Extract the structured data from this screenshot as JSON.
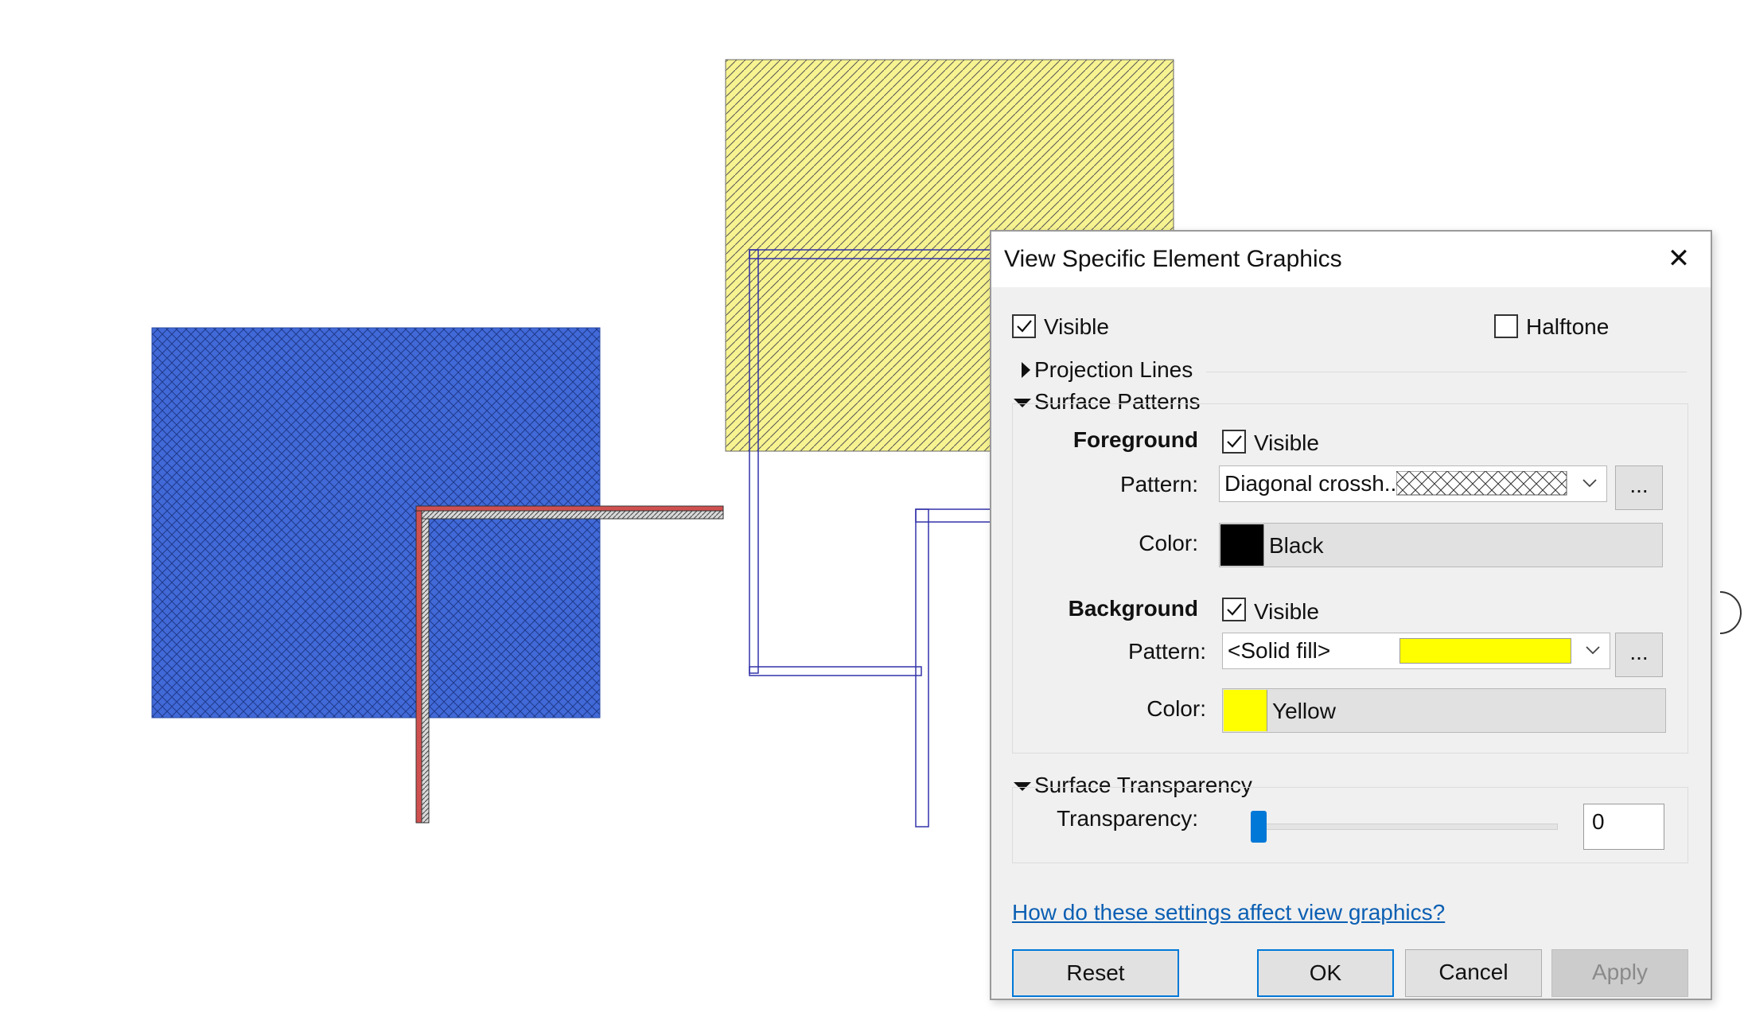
{
  "dialog": {
    "title": "View Specific Element Graphics",
    "close_icon": "close-icon",
    "visible_label": "Visible",
    "visible_checked": true,
    "halftone_label": "Halftone",
    "halftone_checked": false,
    "projection_lines": {
      "label": "Projection Lines",
      "expanded": false
    },
    "surface_patterns": {
      "label": "Surface Patterns",
      "expanded": true,
      "foreground": {
        "heading": "Foreground",
        "visible_label": "Visible",
        "visible_checked": true,
        "pattern_label": "Pattern:",
        "pattern_value": "Diagonal crossh...",
        "pattern_more": "...",
        "color_label": "Color:",
        "color_name": "Black",
        "color_hex": "#000000"
      },
      "background": {
        "heading": "Background",
        "visible_label": "Visible",
        "visible_checked": true,
        "pattern_label": "Pattern:",
        "pattern_value": "<Solid fill>",
        "pattern_swatch_hex": "#ffff00",
        "pattern_more": "...",
        "color_label": "Color:",
        "color_name": "Yellow",
        "color_hex": "#ffff00"
      }
    },
    "surface_transparency": {
      "label": "Surface Transparency",
      "expanded": true,
      "transparency_label": "Transparency:",
      "value": "0",
      "slider_fraction": 0
    },
    "help_link": "How do these settings affect view graphics?",
    "buttons": {
      "reset": "Reset",
      "ok": "OK",
      "cancel": "Cancel",
      "apply": "Apply"
    }
  },
  "canvas": {
    "colors": {
      "blue_region": "#4169d8",
      "yellow_region": "#f7f390",
      "wall_outline": "#3333aa",
      "wall_red": "#d05050",
      "wall_hatch": "#555555"
    }
  }
}
